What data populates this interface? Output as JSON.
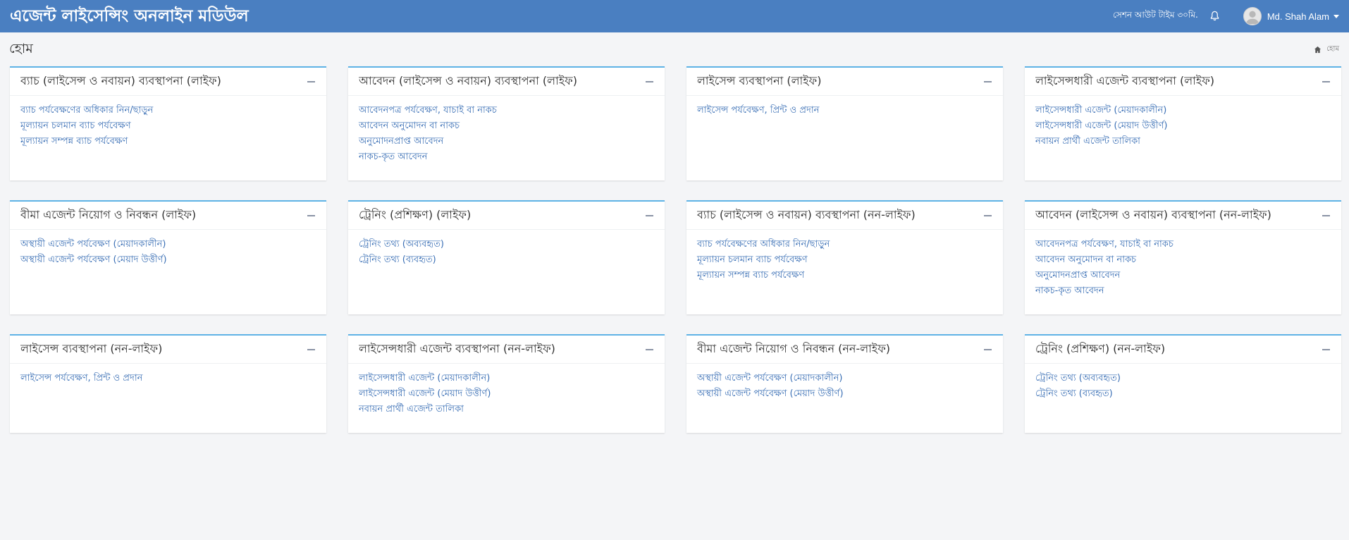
{
  "header": {
    "brand": "এজেন্ট লাইসেন্সিং অনলাইন মডিউল",
    "session": "সেশন আউট টাইম ৩০মি.",
    "user_name": "Md. Shah Alam"
  },
  "page": {
    "title": "হোম",
    "breadcrumb": "হোম"
  },
  "colors": {
    "topbar": "#4a7fc1",
    "panel_border": "#5fb3e6",
    "link": "#3a6fb5"
  },
  "panels": [
    {
      "title": "ব্যাচ (লাইসেন্স ও নবায়ন) ব্যবস্থাপনা (লাইফ)",
      "links": [
        "ব্যাচ পর্যবেক্ষণের অধিকার নিন/ছাড়ুন",
        "মূল্যায়ন চলমান ব্যাচ পর্যবেক্ষণ",
        "মূল্যায়ন সম্পন্ন ব্যাচ পর্যবেক্ষণ"
      ]
    },
    {
      "title": "আবেদন (লাইসেন্স ও নবায়ন) ব্যবস্থাপনা (লাইফ)",
      "links": [
        "আবেদনপত্র পর্যবেক্ষণ, যাচাই বা নাকচ",
        "আবেদন অনুমোদন বা নাকচ",
        "অনুমোদনপ্রাপ্ত আবেদন",
        "নাকচ-কৃত আবেদন"
      ]
    },
    {
      "title": "লাইসেন্স ব্যবস্থাপনা (লাইফ)",
      "links": [
        "লাইসেন্স পর্যবেক্ষণ, প্রিন্ট ও প্রদান"
      ]
    },
    {
      "title": "লাইসেন্সধারী এজেন্ট ব্যবস্থাপনা (লাইফ)",
      "links": [
        "লাইসেন্সধারী এজেন্ট (মেয়াদকালীন)",
        "লাইসেন্সধারী এজেন্ট (মেয়াদ উত্তীর্ণ)",
        "নবায়ন প্রার্থী এজেন্ট তালিকা"
      ]
    },
    {
      "title": "বীমা এজেন্ট নিয়োগ ও নিবন্ধন (লাইফ)",
      "links": [
        "অস্থায়ী এজেন্ট পর্যবেক্ষণ (মেয়াদকালীন)",
        "অস্থায়ী এজেন্ট পর্যবেক্ষণ (মেয়াদ উত্তীর্ণ)"
      ]
    },
    {
      "title": "ট্রেনিং (প্রশিক্ষণ) (লাইফ)",
      "links": [
        "ট্রেনিং তথ্য (অব্যবহৃত)",
        "ট্রেনিং তথ্য (ব্যবহৃত)"
      ]
    },
    {
      "title": "ব্যাচ (লাইসেন্স ও নবায়ন) ব্যবস্থাপনা (নন-লাইফ)",
      "links": [
        "ব্যাচ পর্যবেক্ষণের অধিকার নিন/ছাড়ুন",
        "মূল্যায়ন চলমান ব্যাচ পর্যবেক্ষণ",
        "মূল্যায়ন সম্পন্ন ব্যাচ পর্যবেক্ষণ"
      ]
    },
    {
      "title": "আবেদন (লাইসেন্স ও নবায়ন) ব্যবস্থাপনা (নন-লাইফ)",
      "links": [
        "আবেদনপত্র পর্যবেক্ষণ, যাচাই বা নাকচ",
        "আবেদন অনুমোদন বা নাকচ",
        "অনুমোদনপ্রাপ্ত আবেদন",
        "নাকচ-কৃত আবেদন"
      ]
    },
    {
      "title": "লাইসেন্স ব্যবস্থাপনা (নন-লাইফ)",
      "links": [
        "লাইসেন্স পর্যবেক্ষণ, প্রিন্ট ও প্রদান"
      ]
    },
    {
      "title": "লাইসেন্সধারী এজেন্ট ব্যবস্থাপনা (নন-লাইফ)",
      "links": [
        "লাইসেন্সধারী এজেন্ট (মেয়াদকালীন)",
        "লাইসেন্সধারী এজেন্ট (মেয়াদ উত্তীর্ণ)",
        "নবায়ন প্রার্থী এজেন্ট তালিকা"
      ]
    },
    {
      "title": "বীমা এজেন্ট নিয়োগ ও নিবন্ধন (নন-লাইফ)",
      "links": [
        "অস্থায়ী এজেন্ট পর্যবেক্ষণ (মেয়াদকালীন)",
        "অস্থায়ী এজেন্ট পর্যবেক্ষণ (মেয়াদ উত্তীর্ণ)"
      ]
    },
    {
      "title": "ট্রেনিং (প্রশিক্ষণ) (নন-লাইফ)",
      "links": [
        "ট্রেনিং তথ্য (অব্যবহৃত)",
        "ট্রেনিং তথ্য (ব্যবহৃত)"
      ]
    }
  ]
}
